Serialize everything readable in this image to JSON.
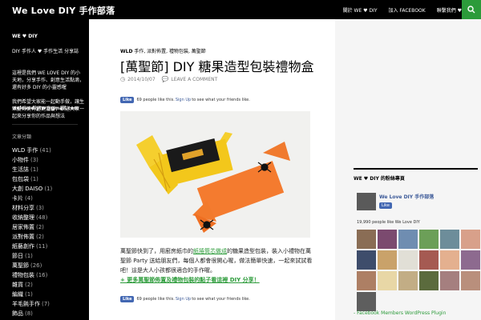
{
  "header": {
    "site_title": "We Love DIY 手作部落",
    "nav": [
      "關於 WE ♥ DIY",
      "加入 FACEBOOK",
      "聯繫我們 ♥"
    ],
    "search_icon": "search-icon"
  },
  "sidebar": {
    "section_title": "WE ♥ DIY",
    "tagline": "DIY 手作人 ♥ 手作生活 分享誌",
    "description_1": "這裡是我們 WE LOVE DIY 的小天地，分享手作、創意生活點滴，還有好多 DIY 的小靈感喔",
    "description_2": "我們希望大家能一起動手做，讓生活變得更有趣更溫暖，歡迎大家一起來分享你的作品與想法",
    "email": "welovediytw@gmail.com",
    "categories_title": "文章分類",
    "categories": [
      {
        "label": "WLD 手作",
        "count": "(41)"
      },
      {
        "label": "小物件",
        "count": "(3)"
      },
      {
        "label": "生活誌",
        "count": "(1)"
      },
      {
        "label": "包包袋",
        "count": "(1)"
      },
      {
        "label": "大創 DAISO",
        "count": "(1)"
      },
      {
        "label": "卡片",
        "count": "(4)"
      },
      {
        "label": "材料分享",
        "count": "(3)"
      },
      {
        "label": "收納整理",
        "count": "(48)"
      },
      {
        "label": "居家佈置",
        "count": "(2)"
      },
      {
        "label": "派對佈置",
        "count": "(2)"
      },
      {
        "label": "紙藝創作",
        "count": "(11)"
      },
      {
        "label": "節日",
        "count": "(1)"
      },
      {
        "label": "萬聖節",
        "count": "(26)"
      },
      {
        "label": "禮物包裝",
        "count": "(16)"
      },
      {
        "label": "雜貨",
        "count": "(2)"
      },
      {
        "label": "編織",
        "count": "(1)"
      },
      {
        "label": "羊毛氈手作",
        "count": "(7)"
      },
      {
        "label": "飾品",
        "count": "(8)"
      }
    ]
  },
  "post": {
    "category_main": "WLD",
    "category_rest": " 手作, 派對佈置, 禮物包裝, 萬聖節",
    "title": "[萬聖節] DIY 糖果造型包裝禮物盒",
    "date": "2014/10/07",
    "comment_link": "LEAVE A COMMENT",
    "like_label": "Like",
    "like_text_pre": "69 people like this.",
    "signup": "Sign Up",
    "like_text_post": "to see what your friends like.",
    "body_pre": "萬聖節快到了，用廚房紙巾的",
    "body_highlight": "紙捲筒芯做成",
    "body_post": "的糖果造型包裝，裝入小禮物在萬聖節 Party 送給朋友們，每個人都會很開心喔，做法簡單快速，一起來試試看吧！這是大人小孩都很適合的手作喔。",
    "more_link": "+ 更多萬聖節佈置及禮物包裝的點子看這裡 DIY 分享！"
  },
  "right_sidebar": {
    "widget_title": "WE ♥ DIY 的粉絲專頁",
    "page_name": "We Love DIY 手作部落",
    "like_label": "Like",
    "like_count": "19,990 people like We Love DIY",
    "plugin_link": "- Facebook Members WordPress Plugin"
  },
  "colors": {
    "accent": "#2c9b3a",
    "black": "#000000",
    "fb_blue": "#4267b2"
  }
}
